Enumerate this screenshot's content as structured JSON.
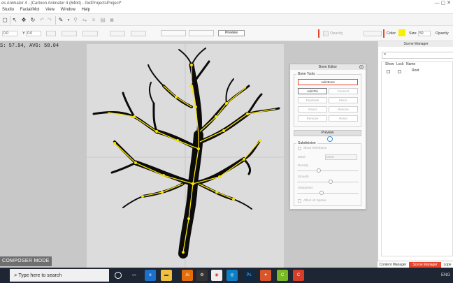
{
  "window": {
    "title": "es Animator 4 - [Cartoon Animator 4 (64bit) - GetProjectsProject*",
    "controls": "— ▢ ✕"
  },
  "menu": [
    "Studio",
    "Facial/Mot",
    "View",
    "Window",
    "Help"
  ],
  "toolbar2": {
    "x_label": "X",
    "x_value": "0.0",
    "y_label": "Y",
    "y_value": "0.0",
    "opacity_label": "Opacity",
    "color_label": "Color",
    "color_value": "#f7f000",
    "size_label": "Size",
    "size_value": "50",
    "preview_button": "Preview"
  },
  "stage": {
    "fps_readout": "S: 57.94, AVG: 58.04",
    "mode_badge": "COMPOSER MODE"
  },
  "bone_editor": {
    "title": "Bone Editor",
    "group_bone_tools": "Bone Tools",
    "add_bone": "Add Bone",
    "add_pin": "Add Pin",
    "connect": "Connect",
    "duplicate": "Duplicate",
    "mirror": "Mirror",
    "reset": "Reset",
    "rebone": "Rebone",
    "remove": "Remove",
    "reset2": "Reset",
    "preview_bar": "Preview",
    "group_subdivision": "Subdivision",
    "show_wireframe": "Show Wireframe",
    "mesh_label": "Mesh",
    "mesh_value": "Mesh",
    "density_label": "Density",
    "smooth_label": "Smooth",
    "sharpness_label": "Sharpness",
    "affect_all_label": "Affect All Sprites",
    "density": 0.35,
    "smooth": 0.55,
    "sharpness": 0.4
  },
  "scene_manager": {
    "title": "Scene Manager",
    "columns": [
      "Show",
      "Lock",
      "Name"
    ],
    "rows": [
      {
        "name": "Root"
      }
    ]
  },
  "panel_tabs": [
    "Content Manager",
    "Scene Manager",
    "Lope"
  ],
  "taskbar": {
    "search_placeholder": "Type here to search",
    "tray_lang": "ENG"
  },
  "colors": {
    "accent": "#e8452c",
    "bone": "#f7e200",
    "tree": "#0b0b0b",
    "workspace": "#c8c8c8",
    "stage": "#dcdcdc"
  }
}
